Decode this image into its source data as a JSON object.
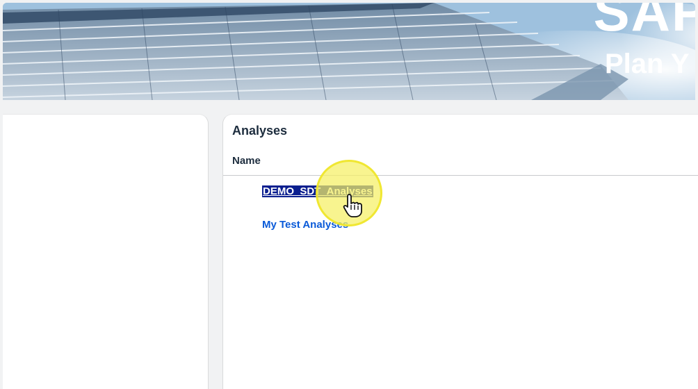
{
  "banner": {
    "title": "SAP",
    "subtitle": "Plan Y"
  },
  "analyses_panel": {
    "title": "Analyses",
    "column_header": "Name",
    "items": [
      {
        "label": "DEMO_SDT_Analyses",
        "selected": true
      },
      {
        "label": "My Test Analyses",
        "selected": false
      }
    ]
  },
  "cursor": {
    "icon": "hand-pointer-icon",
    "highlight_color": "#f5f064"
  },
  "colors": {
    "link": "#0a5ad8",
    "selection": "#0b1f8f",
    "heading": "#1d2d3e"
  }
}
